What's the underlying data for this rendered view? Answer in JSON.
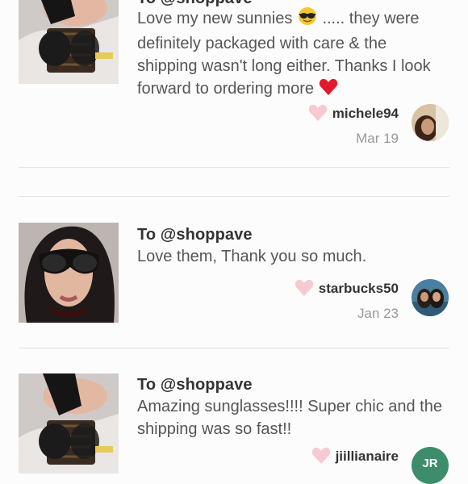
{
  "reviews": [
    {
      "to": "To @shoppave",
      "body_before_emoji": "Love my new sunnies",
      "body_after_emoji": " ..... they were definitely packaged with care & the shipping wasn't long either. Thanks I look forward to ordering more",
      "emoji_1": "sunglasses-face-emoji",
      "emoji_2": "red-heart-emoji",
      "username": "michele94",
      "date": "Mar 19"
    },
    {
      "to": "To @shoppave",
      "body": "Love them, Thank you so much.",
      "username": "starbucks50",
      "date": "Jan 23"
    },
    {
      "to": "To @shoppave",
      "body": "Amazing sunglasses!!!! Super chic and the shipping was so fast!!",
      "username": "jiillianaire",
      "avatar_initials": "JR"
    }
  ],
  "colors": {
    "heart": "#f7c9d0",
    "divider": "#e5e3e4",
    "initials_avatar": "#3d8d6a"
  }
}
